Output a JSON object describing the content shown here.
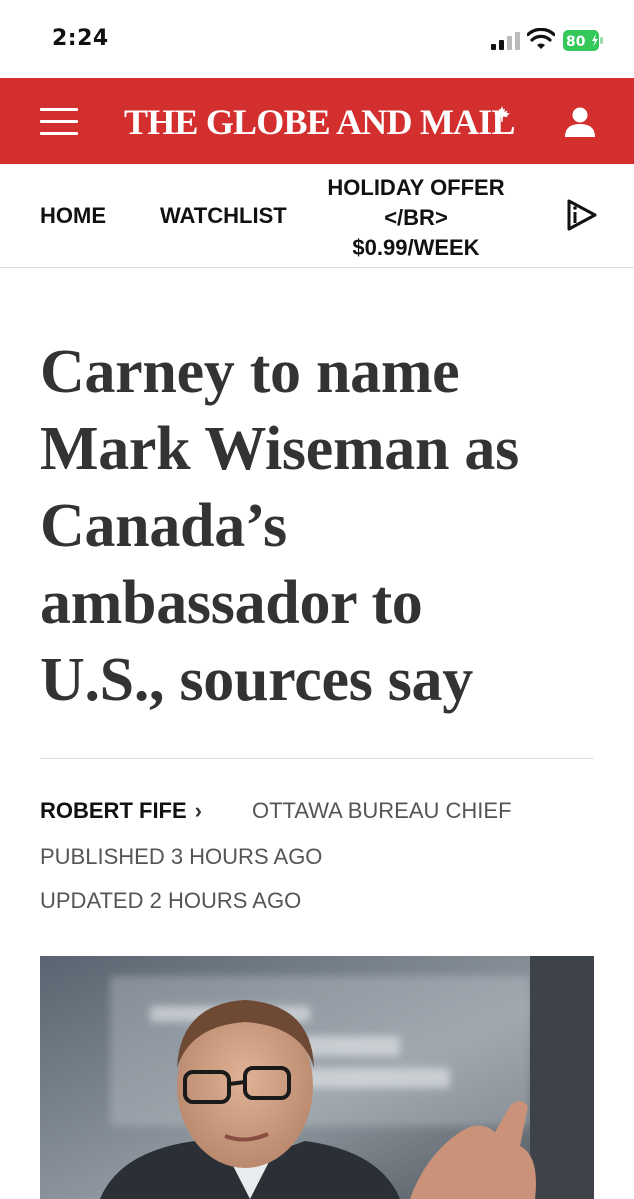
{
  "status_bar": {
    "time": "2:24",
    "battery": "80",
    "icons": [
      "signal-icon",
      "wifi-icon",
      "battery-icon"
    ]
  },
  "masthead": {
    "logo_text": "THE GLOBE AND MAIL",
    "brand_color": "#d32f2f",
    "icons": [
      "menu-icon",
      "maple-leaf-icon",
      "account-icon"
    ]
  },
  "nav": {
    "home": "HOME",
    "watchlist": "WATCHLIST",
    "offer_line1": "HOLIDAY OFFER",
    "offer_line2": "</BR>",
    "offer_line3": "$0.99/WEEK",
    "video_icon": "video-play-icon"
  },
  "article": {
    "headline_lines": [
      "Carney to name",
      "Mark Wiseman as",
      "Canada’s",
      "ambassador to",
      "U.S., sources say"
    ],
    "author": "ROBERT FIFE",
    "author_title": "OTTAWA BUREAU CHIEF",
    "published": "PUBLISHED 3 HOURS AGO",
    "updated": "UPDATED 2 HOURS AGO"
  }
}
